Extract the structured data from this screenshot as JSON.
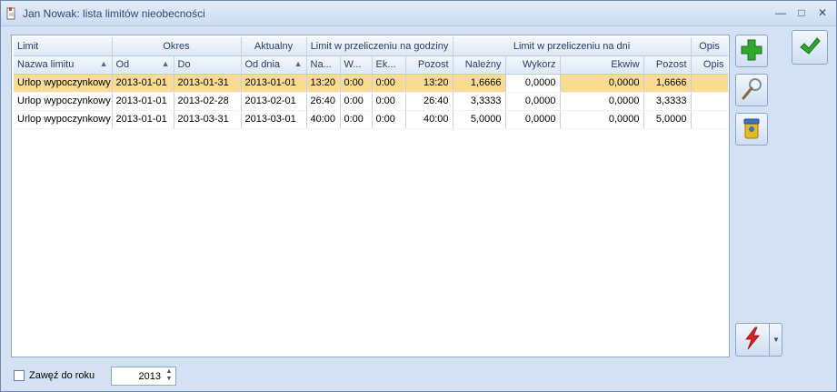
{
  "window": {
    "title": "Jan Nowak: lista limitów nieobecności",
    "minimize_glyph": "—",
    "restore_glyph": "□",
    "close_glyph": "✕"
  },
  "grid": {
    "group_headers": [
      "Limit",
      "Okres",
      "Aktualny",
      "Limit w przeliczeniu na godziny",
      "Limit w przeliczeniu na dni",
      "Opis"
    ],
    "columns": [
      "Nazwa limitu",
      "Od",
      "Do",
      "Od dnia",
      "Na...",
      "W...",
      "Ek...",
      "Pozost",
      "Należny",
      "Wykorz",
      "Ekwiw",
      "Pozost",
      "Opis"
    ],
    "sort_glyph": "▲",
    "rows": [
      [
        "Urlop wypoczynkowy",
        "2013-01-01",
        "2013-01-31",
        "2013-01-01",
        "13:20",
        "0:00",
        "0:00",
        "13:20",
        "1,6666",
        "0,0000",
        "0,0000",
        "1,6666",
        ""
      ],
      [
        "Urlop wypoczynkowy",
        "2013-01-01",
        "2013-02-28",
        "2013-02-01",
        "26:40",
        "0:00",
        "0:00",
        "26:40",
        "3,3333",
        "0,0000",
        "0,0000",
        "3,3333",
        ""
      ],
      [
        "Urlop wypoczynkowy",
        "2013-01-01",
        "2013-03-31",
        "2013-03-01",
        "40:00",
        "0:00",
        "0:00",
        "40:00",
        "5,0000",
        "0,0000",
        "0,0000",
        "5,0000",
        ""
      ]
    ]
  },
  "filter": {
    "checkbox_label": "Zawęź do roku",
    "year_value": "2013",
    "spin_up": "▲",
    "spin_down": "▼"
  },
  "toolbar": {
    "dropdown_glyph": "▼"
  },
  "icons": {
    "add": "plus-icon",
    "edit": "magnifier-icon",
    "delete": "trash-bin-icon",
    "batch": "lightning-icon",
    "ok": "checkmark-icon",
    "app": "document-icon"
  },
  "colors": {
    "selected_row": "#f9dc8f",
    "title_text": "#2a4a7c",
    "accent_green": "#2fa82f"
  }
}
